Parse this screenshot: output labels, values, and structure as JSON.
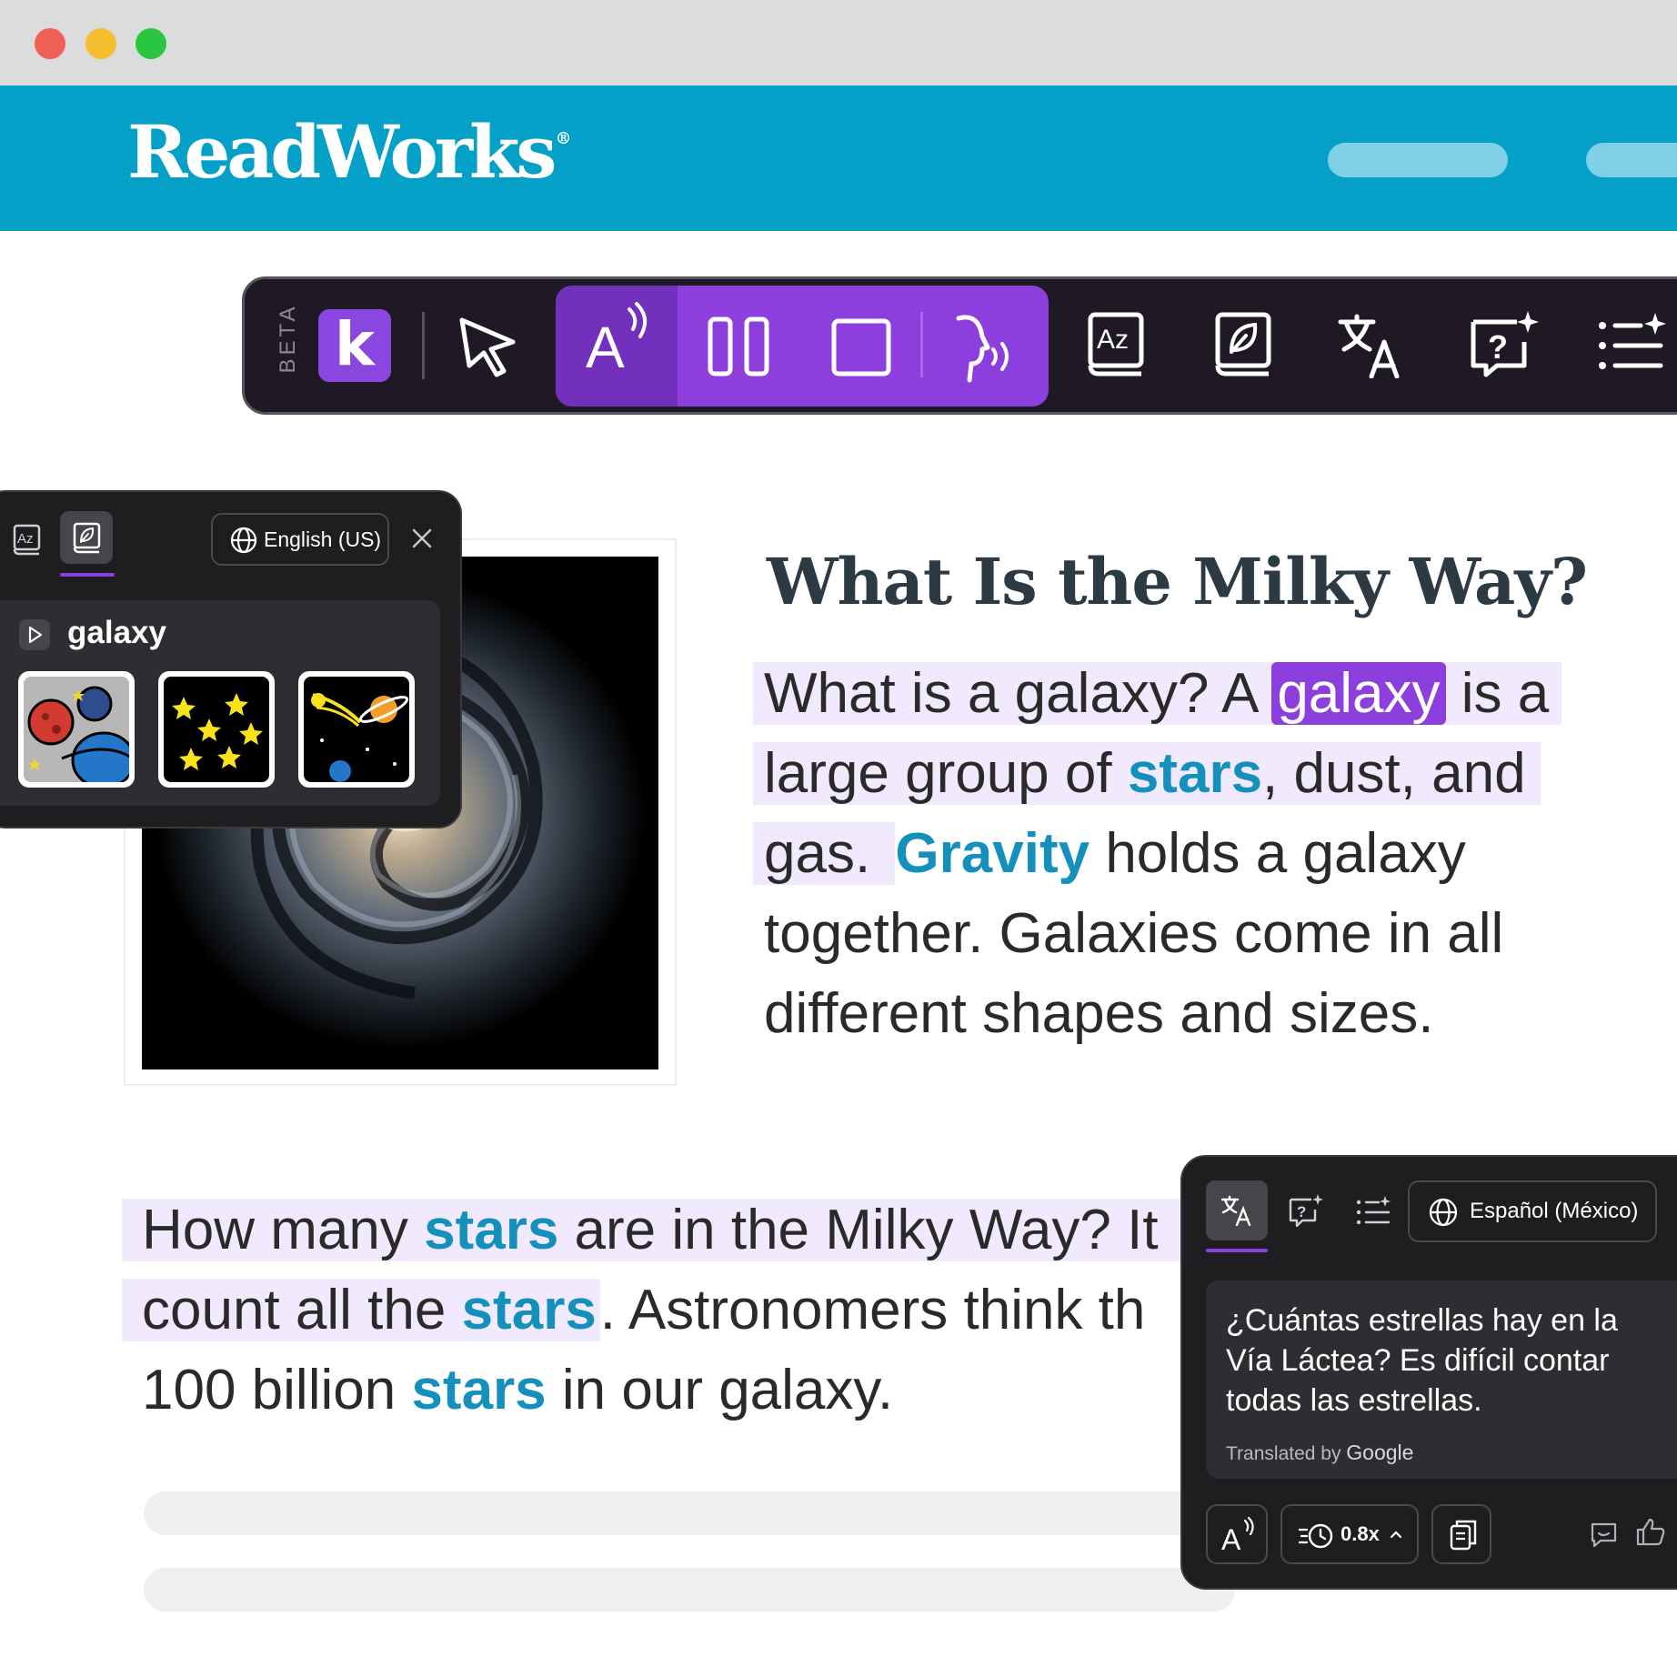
{
  "window": {
    "controls": [
      "close",
      "minimize",
      "maximize"
    ]
  },
  "header": {
    "logo": "ReadWorks",
    "registered": "®"
  },
  "toolbar": {
    "beta": "BETA",
    "brand_letter": "k",
    "icons": [
      "cursor-icon",
      "read-aloud-icon",
      "columns-icon",
      "focus-box-icon",
      "speech-icon",
      "dictionary-icon",
      "picture-dictionary-icon",
      "translate-icon",
      "ask-question-icon",
      "summarize-icon"
    ],
    "accent": "#8d3fdd"
  },
  "article": {
    "title": "What Is the Milky Way?",
    "p1": {
      "l1_a": "What is a galaxy? A ",
      "l1_word": "galaxy",
      "l1_b": " is a",
      "l2_a": "large group of ",
      "l2_vocab": "stars",
      "l2_b": ", dust, and",
      "l3_a": "gas. ",
      "l3_vocab": "Gravity",
      "l3_b": " holds a galaxy",
      "l4": "together. Galaxies come in all",
      "l5": "different shapes and sizes."
    },
    "p2": {
      "l1_a": "How many ",
      "l1_vocab": "stars",
      "l1_b": " are in the Milky Way? It",
      "l2_a": "count all the ",
      "l2_vocab": "stars",
      "l2_b": ". Astronomers think th",
      "l3_a": "100 billion ",
      "l3_vocab": "stars",
      "l3_b": " in our galaxy."
    }
  },
  "dictionary_panel": {
    "language": "English (US)",
    "word": "galaxy",
    "images": [
      "planets-image",
      "stars-image",
      "comet-planet-image"
    ]
  },
  "translation_panel": {
    "language": "Español (México)",
    "text": "¿Cuántas estrellas hay en la Vía Láctea? Es difícil contar todas las estrellas.",
    "credit_prefix": "Translated by ",
    "credit_brand": "Google",
    "speed": "0.8x"
  }
}
